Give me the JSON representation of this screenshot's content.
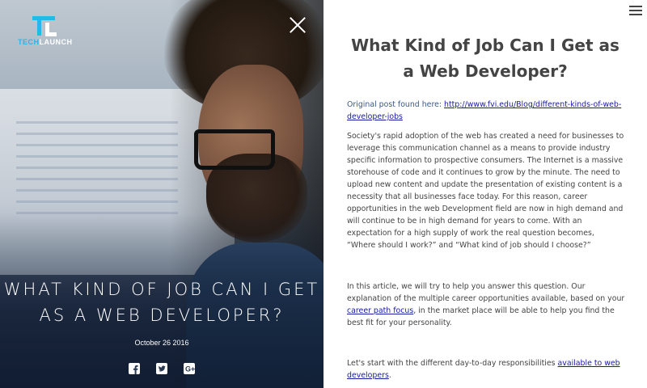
{
  "logo": {
    "text_part1": "TECH",
    "text_part2": "LAUNCH"
  },
  "hero": {
    "title": "WHAT KIND OF JOB CAN I GET AS A WEB DEVELOPER?",
    "date": "October 26 2016",
    "social": [
      "facebook-icon",
      "twitter-icon",
      "google-plus-icon"
    ]
  },
  "article": {
    "title": "What Kind of Job Can I Get as a Web Developer?",
    "original_label": "Original post found here: ",
    "original_link": "http://www.fvi.edu/Blog/different-kinds-of-web-developer-jobs",
    "p1": "Society's rapid adoption of the web has created a need for businesses to leverage this communication channel as a means to provide industry specific information to prospective consumers. The Internet is a massive storehouse of code and it continues to grow by the minute. The need to upload new content and update the presentation of existing content is a necessity that all businesses face today. For this reason, career opportunities in the web Development field are now in high demand and will continue to be in high demand for years to come. With an expectation for a high supply of work the real question becomes, “Where should I work?” and “What kind of job should I choose?”",
    "p2_before": "In this article, we will try to help you answer this question. Our explanation of the multiple career opportunities available, based on your ",
    "p2_link": "career path focus",
    "p2_after": ", in the market place will be able to help you find the best fit for your personality.",
    "p3_before": "Let's start with the different day-to-day responsibilities ",
    "p3_link": "available to web developers",
    "p3_after": "."
  },
  "colors": {
    "accent": "#25b9e6",
    "link": "#1a1aa6",
    "text": "#444444"
  }
}
